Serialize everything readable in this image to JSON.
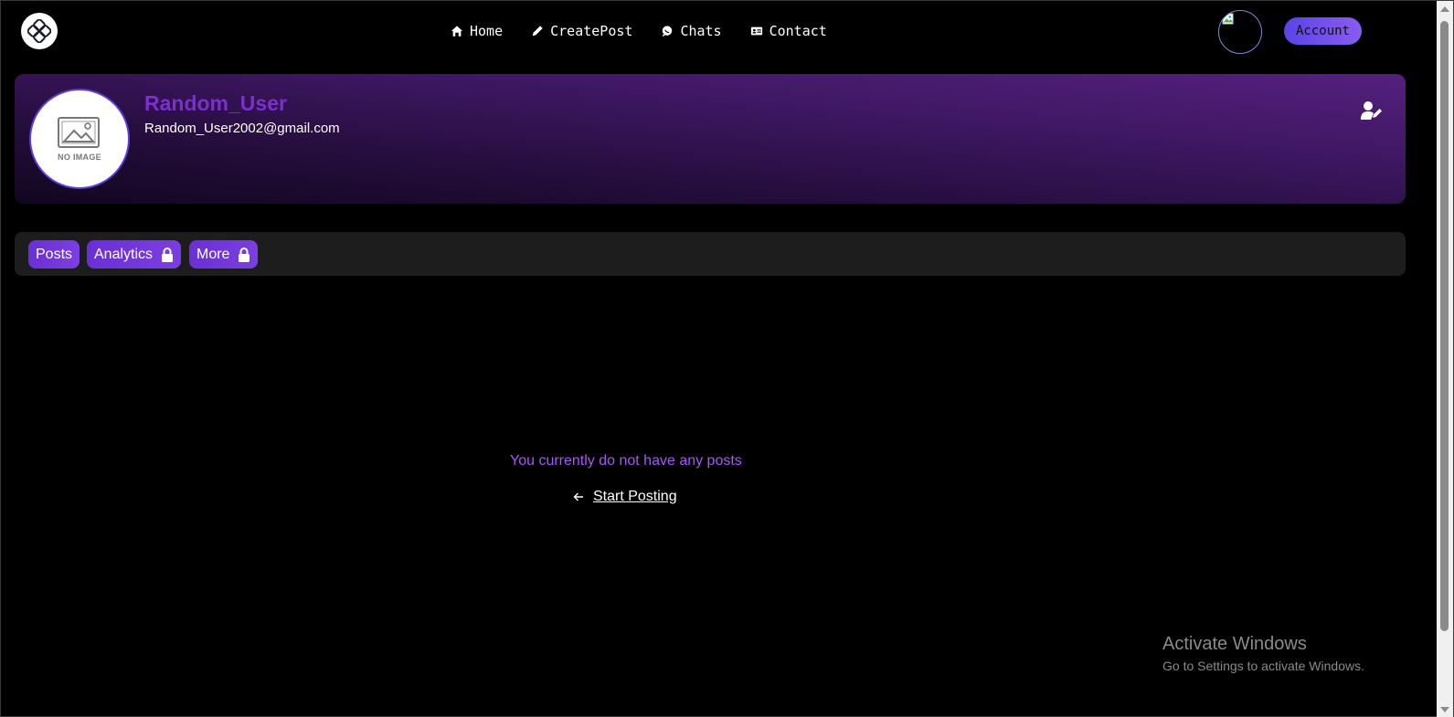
{
  "nav": {
    "links": [
      {
        "label": "Home",
        "icon": "home-icon"
      },
      {
        "label": "CreatePost",
        "icon": "pencil-icon"
      },
      {
        "label": "Chats",
        "icon": "chat-bubble-icon"
      },
      {
        "label": "Contact",
        "icon": "contact-card-icon"
      }
    ],
    "account_label": "Account"
  },
  "profile": {
    "username": "Random_User",
    "email": "Random_User2002@gmail.com",
    "no_image_label": "NO IMAGE"
  },
  "tabs": [
    {
      "label": "Posts",
      "locked": false
    },
    {
      "label": "Analytics",
      "locked": true
    },
    {
      "label": "More",
      "locked": true
    }
  ],
  "empty_state": {
    "message": "You currently do not have any posts",
    "cta_label": "Start Posting"
  },
  "watermark": {
    "title": "Activate Windows",
    "subtitle": "Go to Settings to activate Windows."
  },
  "colors": {
    "accent": "#7b2fd0",
    "button_gradient_start": "#5a44e6",
    "empty_message": "#a855f7"
  }
}
